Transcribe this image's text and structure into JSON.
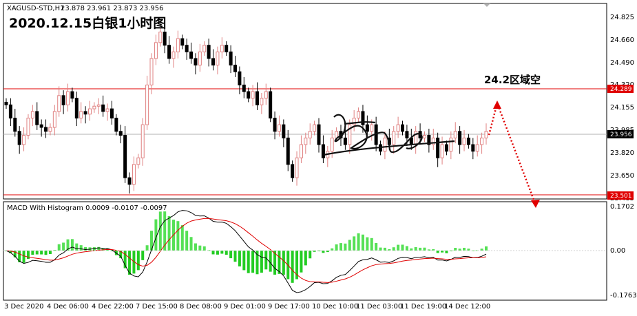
{
  "window": {
    "symbol_info": "XAGUSD-STD,H1",
    "ohlc": "23.878 23.961 23.873 23.956"
  },
  "overlay_title": "2020.12.15白银1小时图",
  "annotation": "24.2区域空",
  "price_axis": {
    "ticks": [
      "24.825",
      "24.660",
      "24.490",
      "24.320",
      "24.155",
      "23.985",
      "23.820",
      "23.650",
      "23.485"
    ],
    "current_price_label": "23.956",
    "resistance_label": "24.289",
    "support_label": "23.501"
  },
  "time_axis": {
    "labels": [
      "3 Dec 2020",
      "4 Dec 06:00",
      "4 Dec 22:00",
      "7 Dec 15:00",
      "8 Dec 08:00",
      "9 Dec 01:00",
      "9 Dec 17:00",
      "10 Dec 10:00",
      "11 Dec 03:00",
      "11 Dec 19:00",
      "14 Dec 12:00"
    ]
  },
  "macd": {
    "title": "MACD With Histogram 0.0009 -0.0107 -0.0097",
    "ticks": [
      "0.1702",
      "0.00",
      "-0.1763"
    ]
  },
  "colors": {
    "bull": "#f0a0a0",
    "bear": "#000000",
    "level_line": "#e00000",
    "hist_pos": "#55e055",
    "hist_neg": "#22cc22",
    "arrow": "#e00000",
    "current_tag": "#000000",
    "level_tag": "#e00000"
  },
  "chart_data": {
    "type": "candlestick",
    "symbol": "XAGUSD-STD",
    "timeframe": "H1",
    "price_range": [
      23.45,
      24.9
    ],
    "levels": {
      "resistance": 24.289,
      "support": 23.501,
      "current": 23.956
    },
    "path_close": [
      24.15,
      24.05,
      23.95,
      23.85,
      23.92,
      24.05,
      24.1,
      24.0,
      23.98,
      23.95,
      23.98,
      24.1,
      24.22,
      24.15,
      24.25,
      24.2,
      24.05,
      24.1,
      24.08,
      24.12,
      24.14,
      24.15,
      24.1,
      24.12,
      24.05,
      23.95,
      23.92,
      23.6,
      23.55,
      23.7,
      23.75,
      24.0,
      24.3,
      24.5,
      24.62,
      24.7,
      24.6,
      24.5,
      24.55,
      24.65,
      24.6,
      24.55,
      24.5,
      24.45,
      24.55,
      24.6,
      24.5,
      24.45,
      24.55,
      24.6,
      24.55,
      24.45,
      24.4,
      24.3,
      24.25,
      24.2,
      24.25,
      24.15,
      24.2,
      24.25,
      24.05,
      23.95,
      24.0,
      23.9,
      23.7,
      23.6,
      23.75,
      23.85,
      23.9,
      23.95,
      24.0,
      23.85,
      23.75,
      23.8,
      23.9,
      23.95,
      23.9,
      23.85,
      24.0,
      24.05,
      24.1,
      24.0,
      23.95,
      24.0,
      23.85,
      23.8,
      23.9,
      23.85,
      23.95,
      24.0,
      23.95,
      23.9,
      23.85,
      23.95,
      23.9,
      23.92,
      23.85,
      23.9,
      23.75,
      23.85,
      23.8,
      23.9,
      23.95,
      23.85,
      23.9,
      23.85,
      23.8,
      23.85,
      23.9,
      23.95
    ],
    "projection": {
      "target_zone": 24.2,
      "path": [
        [
          "last",
          23.956
        ],
        [
          "peak",
          24.2
        ],
        [
          "end",
          23.45
        ]
      ]
    },
    "macd": {
      "name": "MACD With Histogram",
      "values": [
        0.0009,
        -0.0107,
        -0.0097
      ],
      "range": [
        -0.1763,
        0.1702
      ]
    }
  }
}
